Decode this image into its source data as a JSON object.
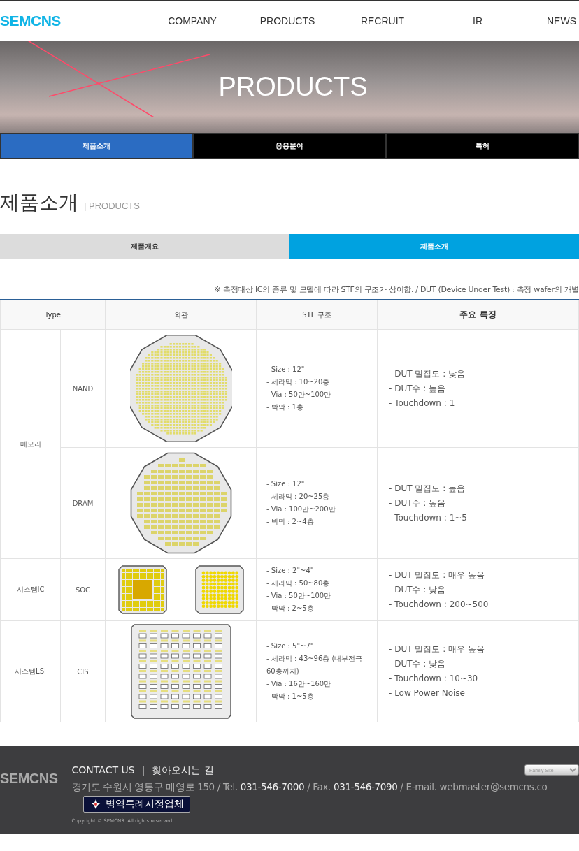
{
  "header": {
    "logo": "SEMCNS",
    "nav": [
      "COMPANY",
      "PRODUCTS",
      "RECRUIT",
      "IR",
      "NEWS"
    ]
  },
  "hero": {
    "title": "PRODUCTS"
  },
  "section_tabs": [
    {
      "label": "제품소개",
      "selected": true
    },
    {
      "label": "응용분야",
      "selected": false
    },
    {
      "label": "특허",
      "selected": false
    }
  ],
  "heading": {
    "title": "제품소개",
    "subtitle": "| PRODUCTS"
  },
  "sub_tabs": [
    {
      "label": "제품개요",
      "selected": false
    },
    {
      "label": "제품소개",
      "selected": true
    }
  ],
  "note": "※ 측정대상 IC의 종류 및 모델에 따라 STF의 구조가 상이함. / DUT (Device Under Test) : 측정 wafer의 개별",
  "table": {
    "columns": [
      "Type",
      "외관",
      "STF 구조",
      "주요 특징"
    ],
    "groups": [
      {
        "type": "메모리",
        "items": [
          {
            "subtype": "NAND",
            "kind": "nand",
            "structure": [
              "- Size : 12\"",
              "- 세라믹 : 10~20층",
              "- Via : 50만~100만",
              "- 박막 : 1층"
            ],
            "features": [
              "- DUT 밀집도 : 낮음",
              "- DUT수 : 높음",
              "- Touchdown : 1"
            ]
          },
          {
            "subtype": "DRAM",
            "kind": "dram",
            "structure": [
              "- Size : 12\"",
              "- 세라믹 : 20~25층",
              "- Via : 100만~200만",
              "- 박막 : 2~4층"
            ],
            "features": [
              "- DUT 밀집도 : 높음",
              "- DUT수 : 높음",
              "- Touchdown : 1~5"
            ]
          }
        ]
      },
      {
        "type": "시스템IC",
        "items": [
          {
            "subtype": "SOC",
            "kind": "soc",
            "structure": [
              "- Size : 2\"~4\"",
              "- 세라믹 : 50~80층",
              "- Via : 50만~100만",
              "- 박막 : 2~5층"
            ],
            "features": [
              "- DUT 밀집도 : 매우 높음",
              "- DUT수 : 낮음",
              "- Touchdown : 200~500"
            ]
          }
        ]
      },
      {
        "type": "시스템LSI",
        "items": [
          {
            "subtype": "CIS",
            "kind": "cis",
            "structure": [
              "- Size : 5\"~7\"",
              "- 세라믹 : 43~96층 (내부전극 60층까지)",
              "- Via : 16만~160만",
              "- 박막 : 1~5층"
            ],
            "features": [
              "- DUT 밀집도 : 매우 높음",
              "- DUT수 : 낮음",
              "- Touchdown : 10~30",
              "- Low Power Noise"
            ]
          }
        ]
      }
    ]
  },
  "footer": {
    "logo": "SEMCNS",
    "links": [
      "CONTACT US",
      "찾아오시는 길"
    ],
    "separator": "|",
    "address": "경기도 수원시 영통구 매영로 150 / Tel. **031-546-7000** / Fax. **031-546-7090** / E-mail. webmaster@semcns.co",
    "badge": "병역특례지정업체",
    "copyright": "Copyright © SEMCNS. All rights reserved.",
    "family_site": "Family Site"
  }
}
